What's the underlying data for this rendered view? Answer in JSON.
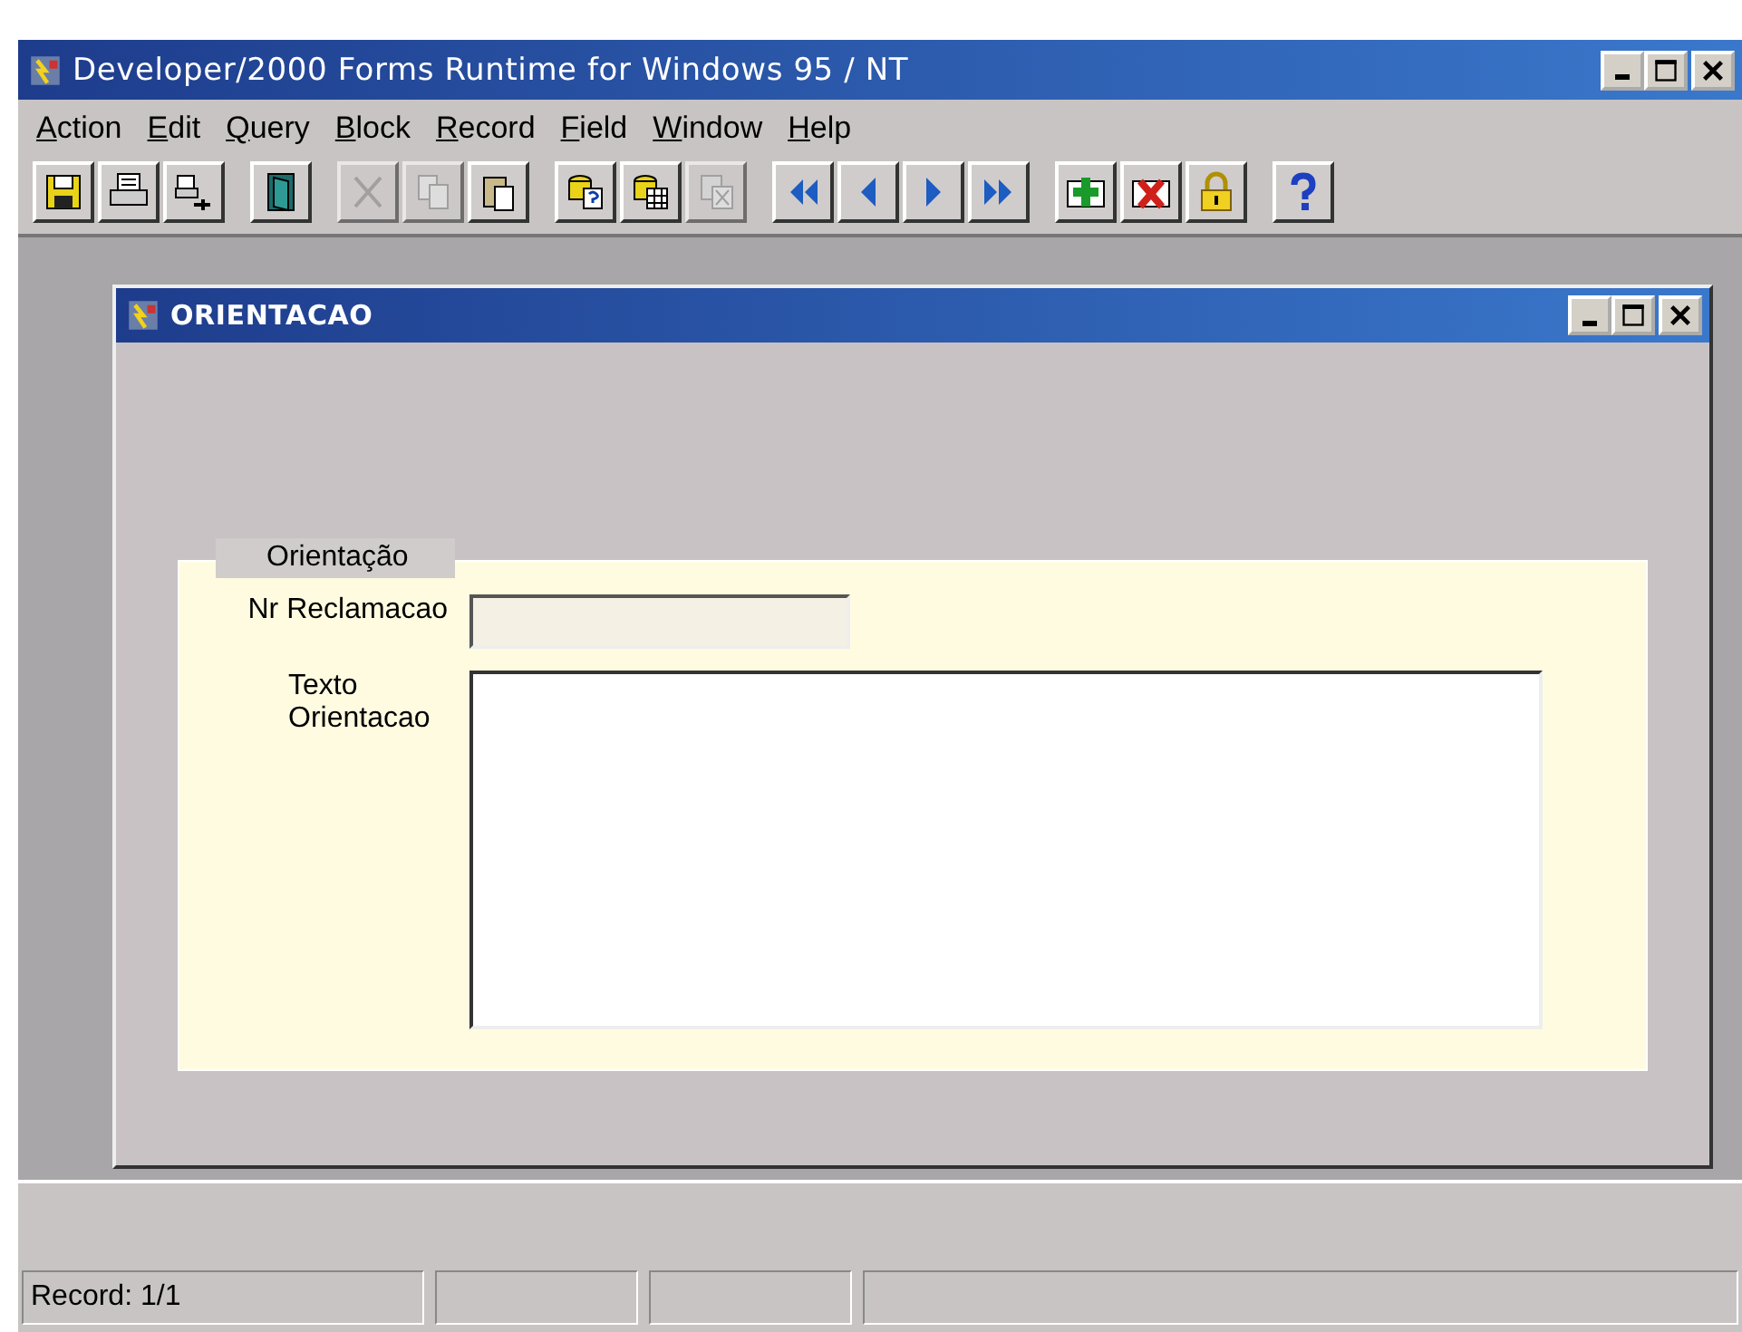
{
  "window": {
    "title": "Developer/2000 Forms Runtime for Windows 95 / NT"
  },
  "menu": [
    {
      "label": "Action"
    },
    {
      "label": "Edit"
    },
    {
      "label": "Query"
    },
    {
      "label": "Block"
    },
    {
      "label": "Record"
    },
    {
      "label": "Field"
    },
    {
      "label": "Window"
    },
    {
      "label": "Help"
    }
  ],
  "toolbar": [
    [
      {
        "kind": "save",
        "disabled": false
      },
      {
        "kind": "print",
        "disabled": false
      },
      {
        "kind": "print-setup",
        "disabled": false
      }
    ],
    [
      {
        "kind": "exit",
        "disabled": false
      }
    ],
    [
      {
        "kind": "cut",
        "disabled": true
      },
      {
        "kind": "copy",
        "disabled": true
      },
      {
        "kind": "paste",
        "disabled": false
      }
    ],
    [
      {
        "kind": "enter-query",
        "disabled": false
      },
      {
        "kind": "execute-query",
        "disabled": false
      },
      {
        "kind": "cancel-query",
        "disabled": true
      }
    ],
    [
      {
        "kind": "first",
        "disabled": false
      },
      {
        "kind": "previous",
        "disabled": false
      },
      {
        "kind": "next",
        "disabled": false
      },
      {
        "kind": "last",
        "disabled": false
      }
    ],
    [
      {
        "kind": "insert",
        "disabled": false
      },
      {
        "kind": "delete",
        "disabled": false
      },
      {
        "kind": "lock",
        "disabled": false
      }
    ],
    [
      {
        "kind": "help",
        "disabled": false
      }
    ]
  ],
  "child_window": {
    "title": "ORIENTACAO",
    "group": {
      "title": "Orientação",
      "fields": [
        {
          "kind": "text",
          "label": "Nr Reclamacao",
          "disabled": true
        },
        {
          "kind": "textarea",
          "label": "Texto\nOrientacao",
          "disabled": false
        }
      ]
    }
  },
  "status_bar": {
    "cells": [
      "Record: 1/1"
    ]
  }
}
